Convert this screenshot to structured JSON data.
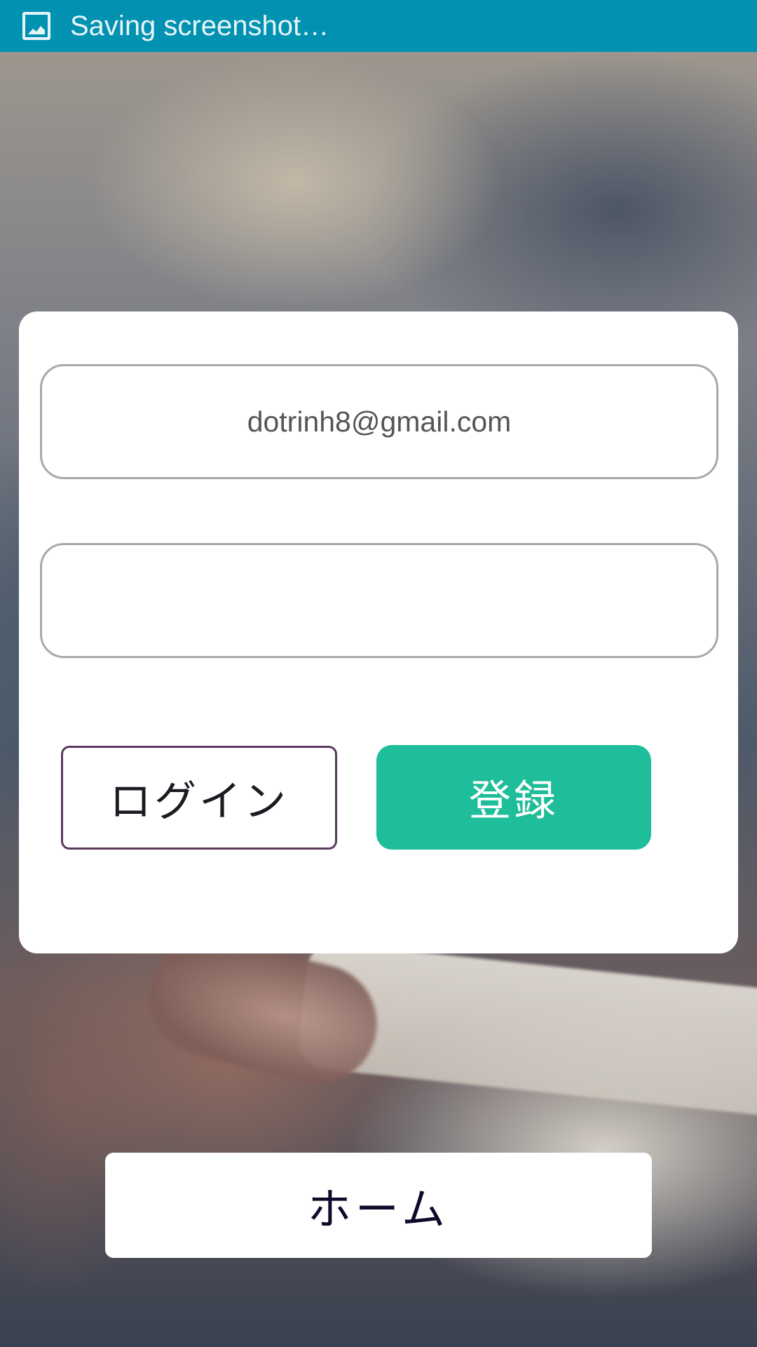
{
  "status_bar": {
    "text": "Saving screenshot…",
    "icon": "image-icon",
    "color": "#0192b2"
  },
  "login_form": {
    "email_value": "dotrinh8@gmail.com",
    "password_value": "",
    "login_button_label": "ログイン",
    "register_button_label": "登録",
    "register_button_color": "#1dbe99"
  },
  "home_button_label": "ホーム"
}
